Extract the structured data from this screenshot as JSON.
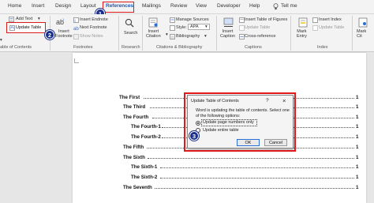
{
  "tabs": [
    "Home",
    "Insert",
    "Design",
    "Layout",
    "References",
    "Mailings",
    "Review",
    "View",
    "Developer",
    "Help",
    "Tell me"
  ],
  "ribbon": {
    "add_text": "Add Text",
    "update_table": "Update Table",
    "insert_footnote": "Insert\nFootnote",
    "insert_endnote": "Insert Endnote",
    "next_footnote": "Next Footnote",
    "show_notes": "Show Notes",
    "search": "Search",
    "insert_citation": "Insert\nCitation",
    "manage_sources": "Manage Sources",
    "style_label": "Style:",
    "style_value": "APA",
    "bibliography": "Bibliography",
    "insert_caption": "Insert\nCaption",
    "insert_table_of_figures": "Insert Table of Figures",
    "update_table_2": "Update Table",
    "cross_reference": "Cross-reference",
    "mark_entry": "Mark\nEntry",
    "insert_index": "Insert Index",
    "update_table_3": "Update Table",
    "mark_cit": "Mark\nCit",
    "groups": {
      "toc": "able of Contents",
      "footnotes": "Footnotes",
      "research": "Research",
      "citations": "Citations & Bibliography",
      "captions": "Captions",
      "index": "Index"
    }
  },
  "badges": [
    "1",
    "2",
    "3"
  ],
  "toc": [
    "The First",
    "The Third",
    "The Fourth",
    "The Fourth-1",
    "The Fourth-2",
    "The Fifth",
    "The Sixth",
    "The Sixth-1",
    "The Sixth-2",
    "The Seventh"
  ],
  "toc_page": "1",
  "dialog": {
    "title": "Update Table of Contents",
    "help": "?",
    "close": "×",
    "message1": "Word is updating the table of contents.  Select one",
    "message2": "of the following options:",
    "opt1": "Update page numbers only",
    "opt2": "Update entire table",
    "ok": "OK",
    "cancel": "Cancel",
    "selected": "Update page numbers only"
  }
}
